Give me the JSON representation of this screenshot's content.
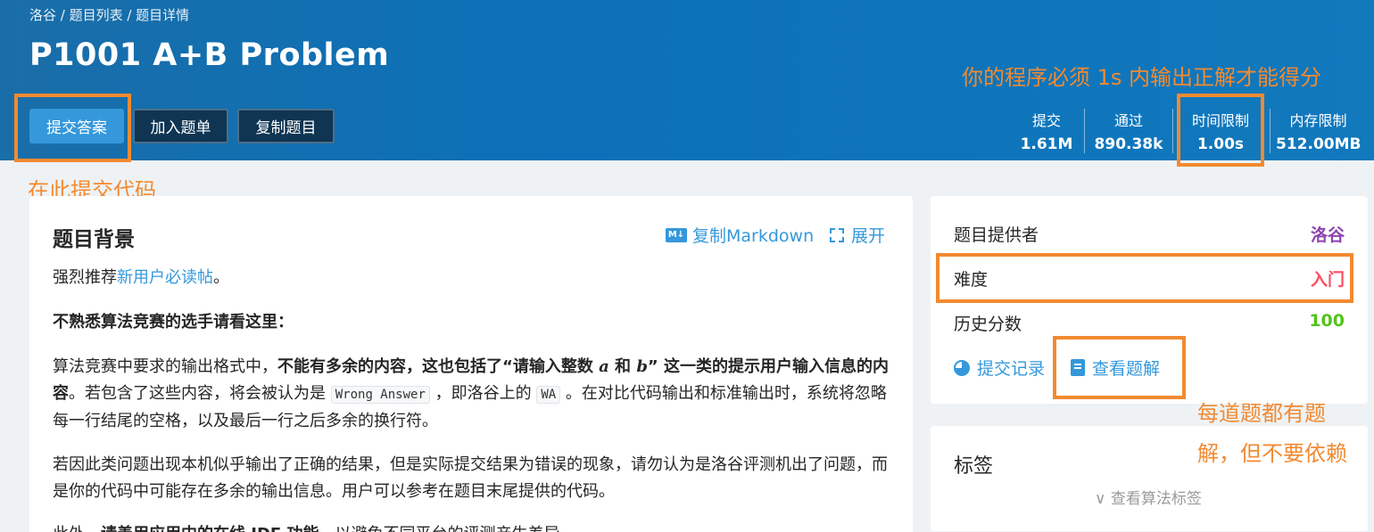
{
  "breadcrumb": "洛谷 / 题目列表 / 题目详情",
  "problem": {
    "title": "P1001 A+B Problem"
  },
  "actions": {
    "submit": "提交答案",
    "add_to_list": "加入题单",
    "copy_problem": "复制题目"
  },
  "stats": [
    {
      "label": "提交",
      "value": "1.61M"
    },
    {
      "label": "通过",
      "value": "890.38k"
    },
    {
      "label": "时间限制",
      "value": "1.00s"
    },
    {
      "label": "内存限制",
      "value": "512.00MB"
    }
  ],
  "annotations": {
    "time_limit_note": "你的程序必须 1s 内输出正解才能得分",
    "submit_note": "在此提交代码",
    "solution_note_line1": "每道题都有题",
    "solution_note_line2": "解，但不要依赖"
  },
  "content": {
    "section_title": "题目背景",
    "copy_markdown": "复制Markdown",
    "md_icon": "M↓",
    "expand": "展开",
    "p1_prefix": "强烈推荐",
    "p1_link": "新用户必读帖",
    "p1_suffix": "。",
    "p2": "不熟悉算法竞赛的选手请看这里：",
    "p3_a": "算法竞赛中要求的输出格式中，",
    "p3_b": "不能有多余的内容",
    "p3_c": "，这也包括了“请输入整数 ",
    "p3_var_a": "a",
    "p3_d": " 和 ",
    "p3_var_b": "b",
    "p3_e": "” 这一类的提示用户输入信息的内容",
    "p3_f": "。若包含了这些内容，将会被认为是 ",
    "p3_code1": "Wrong Answer",
    "p3_g": " ，即洛谷上的 ",
    "p3_code2": "WA",
    "p3_h": " 。在对比代码输出和标准输出时，系统将忽略每一行结尾的空格，以及最后一行之后多余的换行符。",
    "p4": "若因此类问题出现本机似乎输出了正确的结果，但是实际提交结果为错误的现象，请勿认为是洛谷评测机出了问题，而是你的代码中可能存在多余的输出信息。用户可以参考在题目末尾提供的代码。",
    "p5_a": "此外，",
    "p5_b": "请善用应用中的在线 IDE 功能",
    "p5_c": "，以避免不同平台的评测产生差异。"
  },
  "sidebar": {
    "provider_label": "题目提供者",
    "provider_value": "洛谷",
    "difficulty_label": "难度",
    "difficulty_value": "入门",
    "score_label": "历史分数",
    "score_value": "100",
    "records_link": "提交记录",
    "solutions_link": "查看题解",
    "tags_title": "标签",
    "tags_more": "∨ 查看算法标签"
  }
}
